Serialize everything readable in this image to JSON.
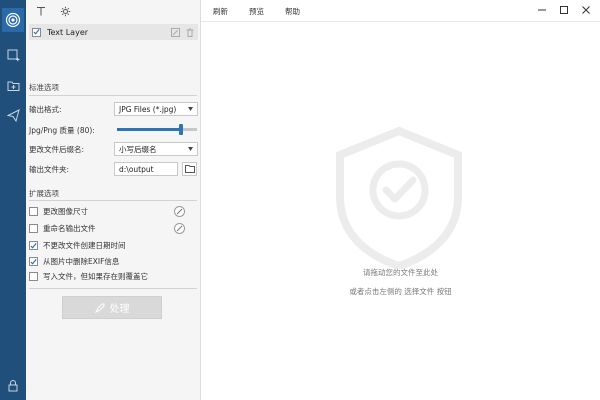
{
  "layers": {
    "items": [
      {
        "name": "Text Layer",
        "checked": true
      }
    ]
  },
  "standard": {
    "title": "标准选项",
    "format_label": "输出格式:",
    "format_value": "JPG Files (*.jpg)",
    "quality_label": "Jpg/Png 质量 (80):",
    "quality_value": 80,
    "rename_label": "更改文件后缀名:",
    "rename_value": "小写后缀名",
    "folder_label": "输出文件夹:",
    "folder_value": "d:\\output"
  },
  "extended": {
    "title": "扩展选项",
    "options": [
      {
        "label": "更改图像尺寸",
        "checked": false,
        "has_settings": true
      },
      {
        "label": "重命名输出文件",
        "checked": false,
        "has_settings": true
      },
      {
        "label": "不更改文件创建日期时间",
        "checked": true,
        "has_settings": false
      },
      {
        "label": "从图片中删除EXIF信息",
        "checked": true,
        "has_settings": false
      },
      {
        "label": "写入文件，但如果存在则覆盖它",
        "checked": false,
        "has_settings": false
      }
    ]
  },
  "process_label": "处理",
  "menu": {
    "refresh": "刷新",
    "preview": "预览",
    "help": "帮助"
  },
  "drop": {
    "line1": "请拖动您的文件至此处",
    "line2": "或者点击左侧的 选择文件 按钮"
  },
  "icons": {
    "rail": [
      "app-logo-icon",
      "add-image-icon",
      "add-folder-icon",
      "send-icon",
      "lock-icon"
    ],
    "toolbar": [
      "text-tool-icon",
      "settings-icon"
    ]
  },
  "colors": {
    "rail": "#1f4f7a",
    "accent": "#2f74b5",
    "panel_bg": "#f5f5f5"
  }
}
